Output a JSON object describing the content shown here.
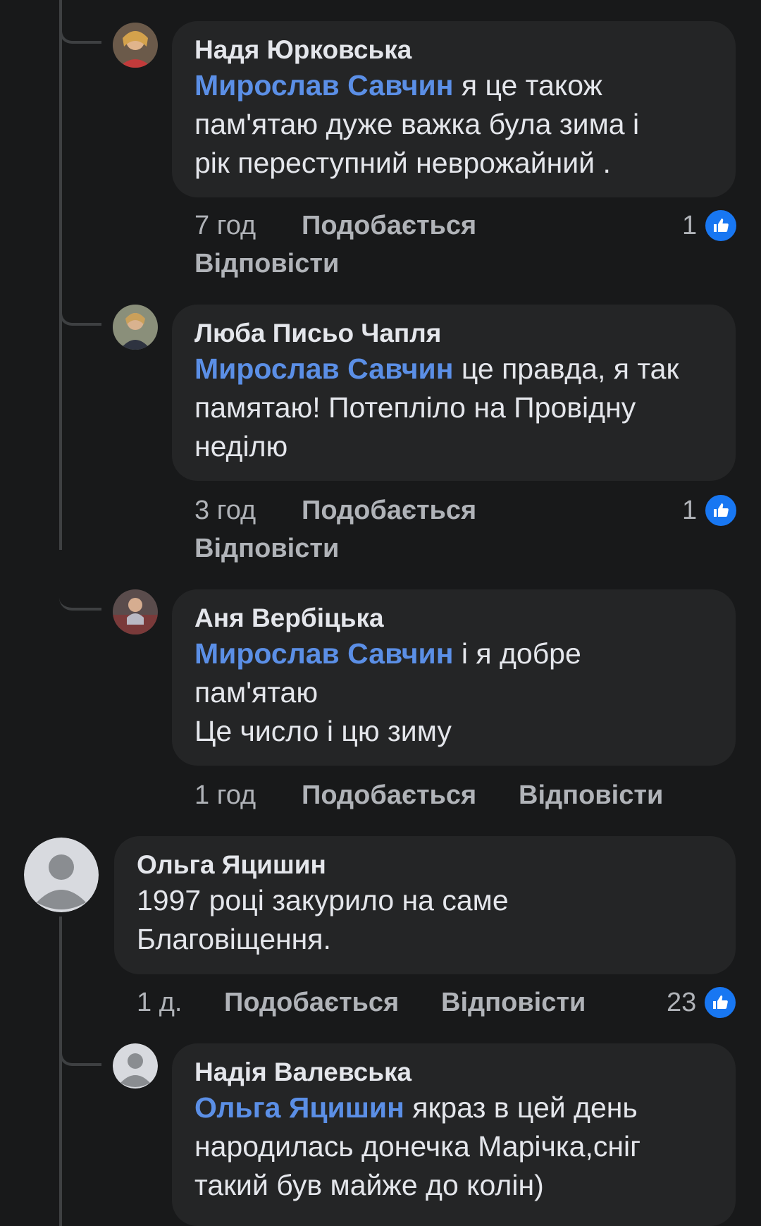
{
  "comments": [
    {
      "author": "Надя Юрковська",
      "mention": "Мирослав Савчин",
      "text": " я це також\nпам'ятаю дуже важка була зима і\nрік переступний  неврожайний .",
      "time": "7 год",
      "like": "Подобається",
      "reply": "Відповісти",
      "reactions": "1"
    },
    {
      "author": "Люба Письо Чапля",
      "mention": "Мирослав Савчин",
      "text": " це правда, я так\nпамятаю! Потепліло на Провідну\nнеділю",
      "time": "3 год",
      "like": "Подобається",
      "reply": "Відповісти",
      "reactions": "1"
    },
    {
      "author": "Аня Вербіцька",
      "mention": "Мирослав Савчин",
      "text": " і я добре\nпам'ятаю\nЦе число і цю зиму",
      "time": "1 год",
      "like": "Подобається",
      "reply": "Відповісти"
    },
    {
      "author": "Ольга Яцишин",
      "text": "1997 році закурило на саме\nБлаговіщення.",
      "time": "1 д.",
      "like": "Подобається",
      "reply": "Відповісти",
      "reactions": "23"
    },
    {
      "author": "Надія Валевська",
      "mention": "Ольга Яцишин",
      "text": " якраз в цей день\nнародилась донечка Марічка,сніг\nтакий був майже до колін)"
    }
  ],
  "icons": {
    "reaction": "like-thumbs-up-icon",
    "avatar_default": "default-avatar-icon"
  },
  "colors": {
    "background": "#18191a",
    "bubble": "#242526",
    "mention": "#5b8fe6",
    "like": "#1877f2"
  }
}
